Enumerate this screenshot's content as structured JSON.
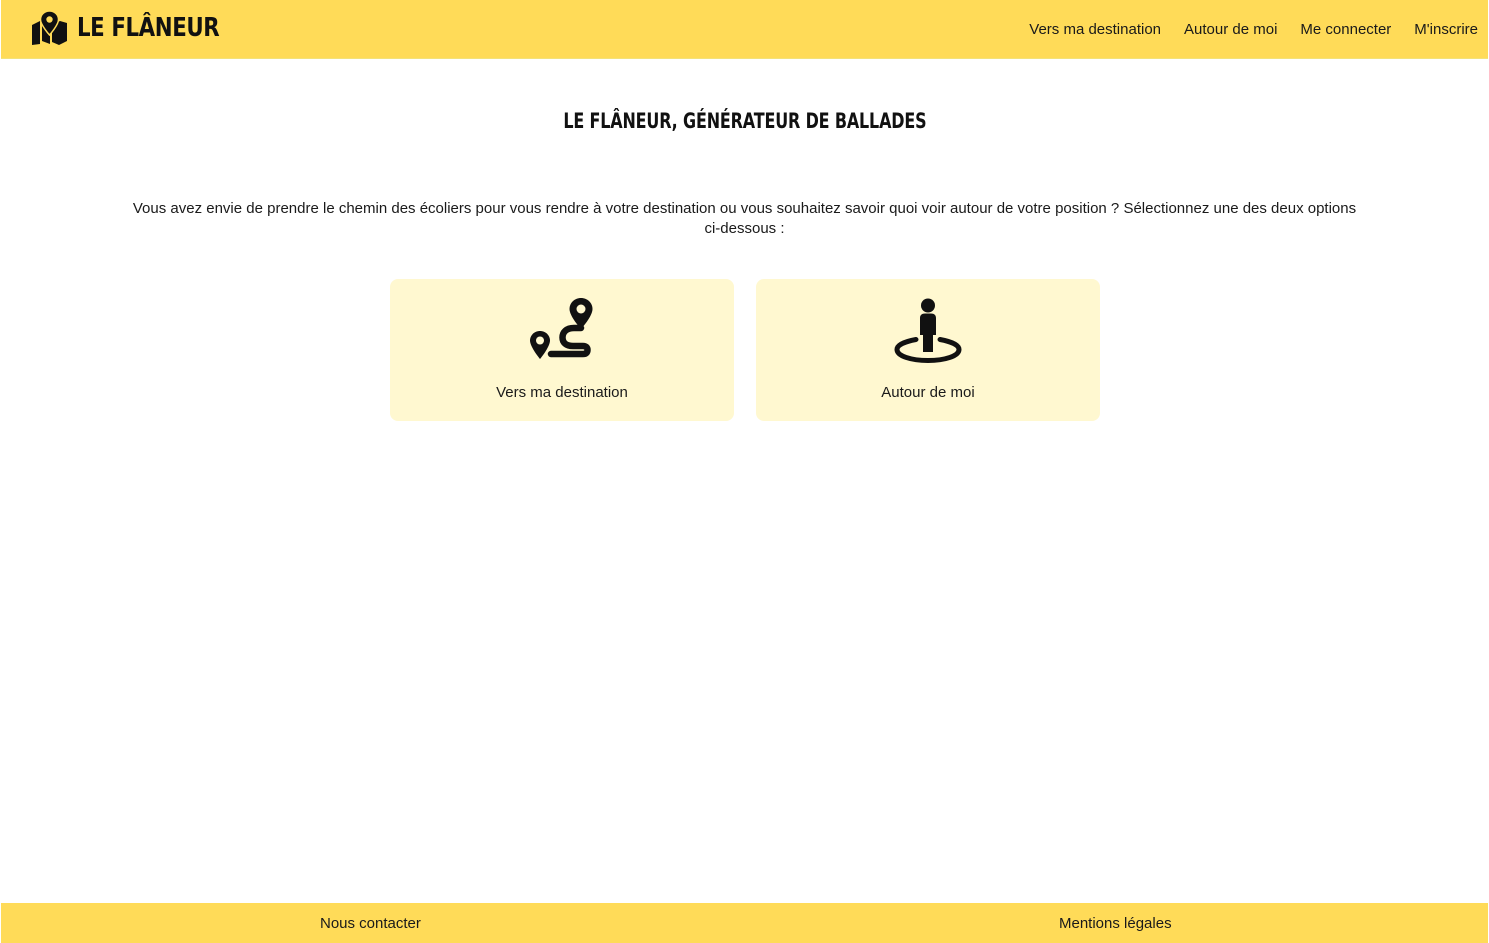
{
  "header": {
    "brand": "LE FLÂNEUR",
    "brand_icon": "map-location-icon",
    "nav": [
      {
        "label": "Vers ma destination"
      },
      {
        "label": "Autour de moi"
      },
      {
        "label": "Me connecter"
      },
      {
        "label": "M'inscrire"
      }
    ]
  },
  "main": {
    "title": "LE FLÂNEUR, GÉNÉRATEUR DE BALLADES",
    "intro": "Vous avez envie de prendre le chemin des écoliers pour vous rendre à votre destination ou vous souhaitez savoir quoi voir autour de votre position ? Sélectionnez une des deux options ci-dessous :",
    "options": [
      {
        "label": "Vers ma destination",
        "icon": "route-icon"
      },
      {
        "label": "Autour de moi",
        "icon": "street-view-icon"
      }
    ]
  },
  "footer": {
    "contact": "Nous contacter",
    "legal": "Mentions légales"
  },
  "colors": {
    "header_bg": "#ffdb58",
    "card_bg": "#fff8d0",
    "text": "#111111"
  }
}
